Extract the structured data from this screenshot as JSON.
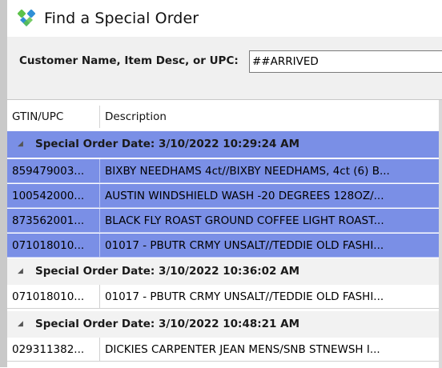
{
  "window": {
    "title": "Find a Special Order",
    "icon": "app-logo-icon"
  },
  "search": {
    "label": "Customer Name, Item Desc, or UPC:",
    "value": "##ARRIVED"
  },
  "grid": {
    "columns": [
      "GTIN/UPC",
      "Description"
    ],
    "groups": [
      {
        "label": "Special Order Date: 3/10/2022 10:29:24 AM",
        "selected": true,
        "rows": [
          {
            "gtin": "859479003...",
            "description": "BIXBY NEEDHAMS 4ct//BIXBY NEEDHAMS, 4ct (6) B..."
          },
          {
            "gtin": "100542000...",
            "description": "AUSTIN WINDSHIELD WASH -20 DEGREES 128OZ/..."
          },
          {
            "gtin": "873562001...",
            "description": "BLACK FLY ROAST GROUND COFFEE LIGHT ROAST..."
          },
          {
            "gtin": "071018010...",
            "description": "01017 - PBUTR CRMY UNSALT//TEDDIE OLD FASHI..."
          }
        ]
      },
      {
        "label": "Special Order Date: 3/10/2022 10:36:02 AM",
        "selected": false,
        "rows": [
          {
            "gtin": "071018010...",
            "description": "01017 - PBUTR CRMY UNSALT//TEDDIE OLD FASHI..."
          }
        ]
      },
      {
        "label": "Special Order Date: 3/10/2022 10:48:21 AM",
        "selected": false,
        "rows": [
          {
            "gtin": "029311382...",
            "description": "DICKIES CARPENTER JEAN MENS/SNB STNEWSH I..."
          }
        ]
      }
    ]
  },
  "colors": {
    "selection": "#7a8fe6",
    "group_background": "#f2f2f2",
    "logo_green": "#5cc24a",
    "logo_blue": "#2f8fd6"
  }
}
